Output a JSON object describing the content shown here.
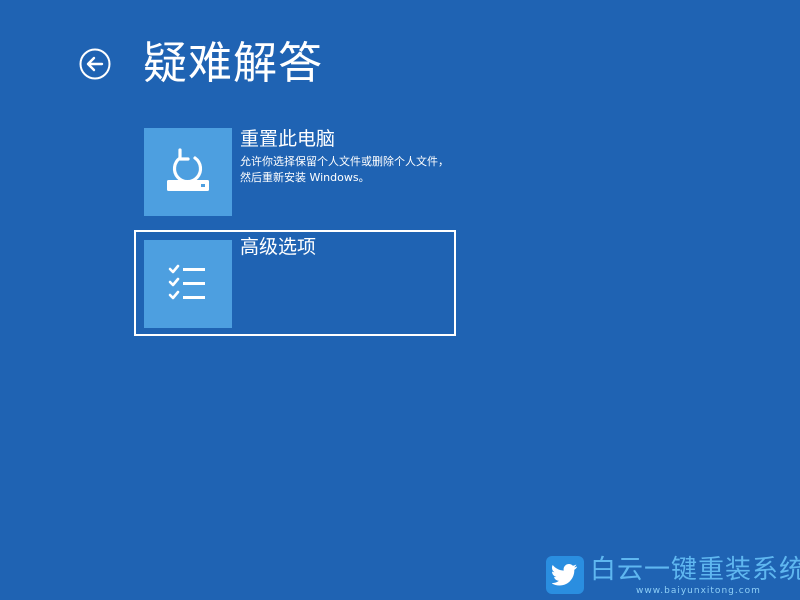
{
  "header": {
    "title": "疑难解答",
    "back_icon": "arrow-left-circle-icon"
  },
  "options": [
    {
      "title": "重置此电脑",
      "description": "允许你选择保留个人文件或删除个人文件，然后重新安装 Windows。",
      "icon": "reset-pc-icon",
      "selected": false
    },
    {
      "title": "高级选项",
      "description": "",
      "icon": "checklist-icon",
      "selected": true
    }
  ],
  "watermark": {
    "brand": "白云一键重装系统",
    "url": "www.baiyunxitong.com",
    "icon": "bird-logo-icon"
  },
  "colors": {
    "background": "#1f63b3",
    "tile": "#4d9fe0",
    "text": "#ffffff",
    "watermark": "#5fb7f0"
  }
}
